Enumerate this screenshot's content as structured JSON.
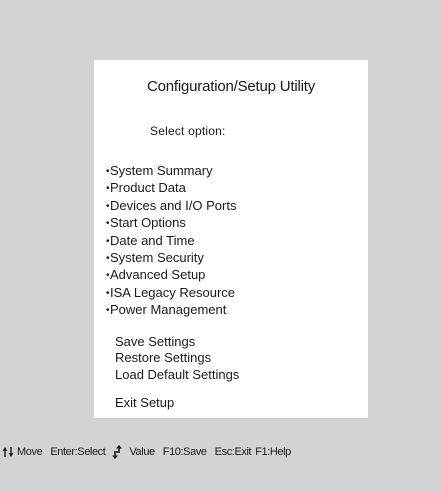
{
  "panel": {
    "title": "Configuration/Setup Utility",
    "subtitle": "Select option:",
    "bullet": "•",
    "menu_items": [
      "System Summary",
      "Product Data",
      "Devices and I/O Ports",
      "Start Options",
      "Date and Time",
      "System Security",
      "Advanced Setup",
      "ISA Legacy Resource",
      "Power Management"
    ],
    "actions": [
      "Save Settings",
      "Restore Settings",
      "Load Default Settings"
    ],
    "exit_label": "Exit Setup"
  },
  "footer": {
    "move_label": "Move",
    "select_label": "Enter:Select",
    "value_label": "Value",
    "save_label": "F10:Save",
    "exit_label": "Esc:Exit",
    "help_label": "F1:Help"
  }
}
